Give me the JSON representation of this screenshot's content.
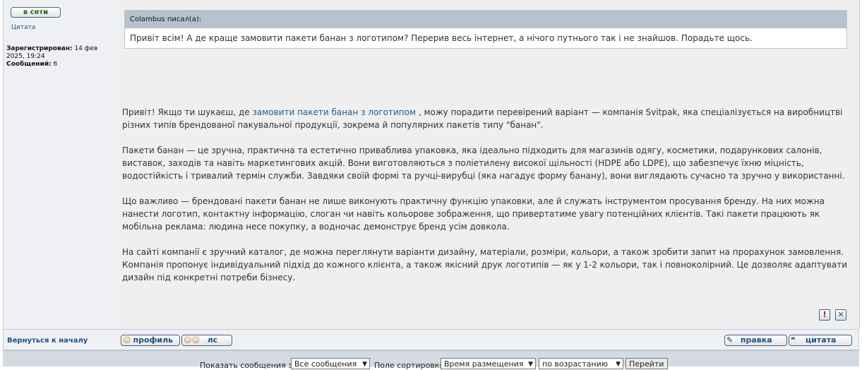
{
  "user": {
    "status_label": "в сети",
    "quote_label": "Цитата",
    "registered_label": "Зарегистрирован:",
    "registered_value": "14 фев 2025, 19:24",
    "messages_label": "Сообщений:",
    "messages_value": "6"
  },
  "quote": {
    "author_line": "Colambus писал(а):",
    "text": "Привіт всім! А де краще замовити пакети банан з логотипом? Перерив весь інтернет, а нічого путнього так і не знайшов. Порадьте щось."
  },
  "post": {
    "p1_before": "Привіт! Якщо ти шукаєш, де ",
    "p1_link": "замовити пакети банан з логотипом",
    "p1_after": " , можу порадити перевірений варіант — компанія Svitpak, яка спеціалізується на виробництві різних типів брендованої пакувальної продукції, зокрема й популярних пакетів типу \"банан\".",
    "p2": "Пакети банан — це зручна, практична та естетично приваблива упаковка, яка ідеально підходить для магазинів одягу, косметики, подарункових салонів, виставок, заходів та навіть маркетингових акцій. Вони виготовляються з поліетилену високої щільності (HDPE або LDPE), що забезпечує їхню міцність, водостійкість і тривалий термін служби. Завдяки своїй формі та ручці-вирубці (яка нагадує форму банану), вони виглядають сучасно та зручно у використанні.",
    "p3": "Що важливо — брендовані пакети банан не лише виконують практичну функцію упаковки, але й служать інструментом просування бренду. На них можна нанести логотип, контактну інформацію, слоган чи навіть кольорове зображення, що привертатиме увагу потенційних клієнтів. Такі пакети працюють як мобільна реклама: людина несе покупку, а водночас демонструє бренд усім довкола.",
    "p4": "На сайті компанії є зручний каталог, де можна переглянути варіанти дизайну, матеріали, розміри, кольори, а також зробити запит на прорахунок замовлення. Компанія пропонує індивідуальний підхід до кожного клієнта, а також якісний друк логотипів — як у 1-2 кольори, так і повноколірний. Це дозволяє адаптувати дизайн під конкретні потреби бізнесу.",
    "report_icon": "!",
    "delete_icon": "✕"
  },
  "footer": {
    "back_label": "Вернуться к началу",
    "profile_label": "профиль",
    "pm_label": "лс",
    "edit_label": "правка",
    "quote_label": "цитата"
  },
  "bottom": {
    "show_label": "Показать сообщения за:",
    "filter_value": "Все сообщения",
    "sort_label": "Поле сортировки:",
    "sort_value": "Время размещения",
    "order_value": "по возрастанию",
    "go_label": "Перейти"
  },
  "colors": {
    "link": "#1f5c8f",
    "quote_header_bg": "#b6c2cd",
    "online_text": "#1e6b13"
  }
}
